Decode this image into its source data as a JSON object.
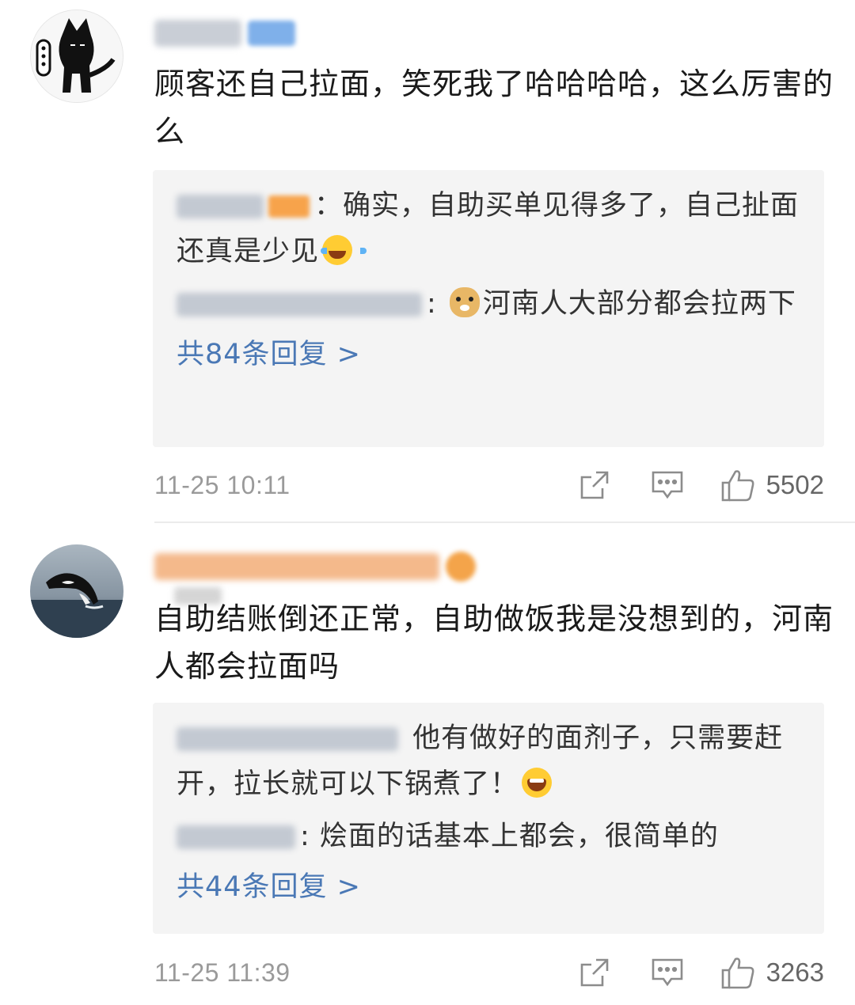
{
  "comments": [
    {
      "username_color": "#c9ced6",
      "badge_color": "#7fb0ea",
      "text": "顾客还自己拉面，笑死我了哈哈哈哈，这么厉害的么",
      "replies": [
        {
          "emoji_after": "laugh-cry-emoji",
          "text": "确实，自助买单见得多了，自己扯面还真是少见"
        },
        {
          "emoji_before": "doge-emoji",
          "text": "河南人大部分都会拉两下"
        }
      ],
      "more_replies": "共84条回复 >",
      "timestamp": "11-25 10:11",
      "likes": "5502"
    },
    {
      "username_color": "#f4b98b",
      "badge_color": "#f4a44a",
      "text": "自助结账倒还正常，自助做饭我是没想到的，河南人都会拉面吗",
      "replies": [
        {
          "text": "他有做好的面剂子，只需要赶开，拉长就可以下锅煮了！",
          "emoji_after": "grin-emoji"
        },
        {
          "text": "烩面的话基本上都会，很简单的"
        }
      ],
      "more_replies": "共44条回复 >",
      "timestamp": "11-25 11:39",
      "likes": "3263"
    }
  ],
  "icons": {
    "share": "share-icon",
    "comment": "comment-icon",
    "like": "thumbs-up-icon"
  },
  "colors": {
    "link": "#4a78b5",
    "reply_bg": "#f4f4f4",
    "meta": "#9a9a9a"
  }
}
